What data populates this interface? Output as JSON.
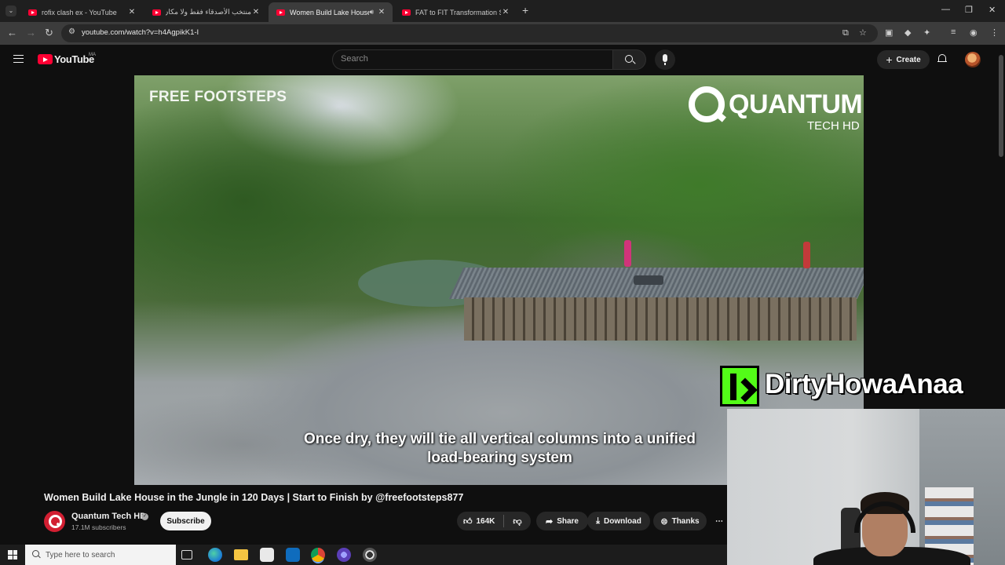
{
  "browser": {
    "tabs": [
      {
        "title": "rofix clash ex - YouTube",
        "active": false
      },
      {
        "title": "منتخب الأصدقاء فقط ولا مكان لك",
        "active": false
      },
      {
        "title": "Women Build Lake House in",
        "active": true
      },
      {
        "title": "FAT to FIT Transformation Series",
        "active": false
      }
    ],
    "url": "youtube.com/watch?v=h4AgpikK1-I"
  },
  "youtube": {
    "logo_text": "YouTube",
    "country_code": "MA",
    "search_placeholder": "Search",
    "create_label": "Create"
  },
  "video": {
    "watermark_left": "FREE FOOTSTEPS",
    "watermark_brand": "QUANTUM",
    "watermark_brand_sub": "TECH HD",
    "caption_line1": "Once dry, they will tie all vertical columns into a unified",
    "caption_line2": "load-bearing system",
    "title": "Women Build Lake House in the Jungle in 120 Days | Start to Finish by @freefootsteps877"
  },
  "channel": {
    "name": "Quantum Tech HD",
    "subscribers": "17.1M subscribers",
    "subscribe_label": "Subscribe"
  },
  "actions": {
    "likes": "164K",
    "share": "Share",
    "download": "Download",
    "thanks": "Thanks",
    "more": "⋯"
  },
  "stream_overlay": {
    "streamer_name": "DirtyHowaAnaa",
    "kick_color": "#53fc18"
  },
  "taskbar": {
    "search_placeholder": "Type here to search"
  },
  "colors": {
    "youtube_red": "#ff0033",
    "background": "#0f0f0f"
  }
}
